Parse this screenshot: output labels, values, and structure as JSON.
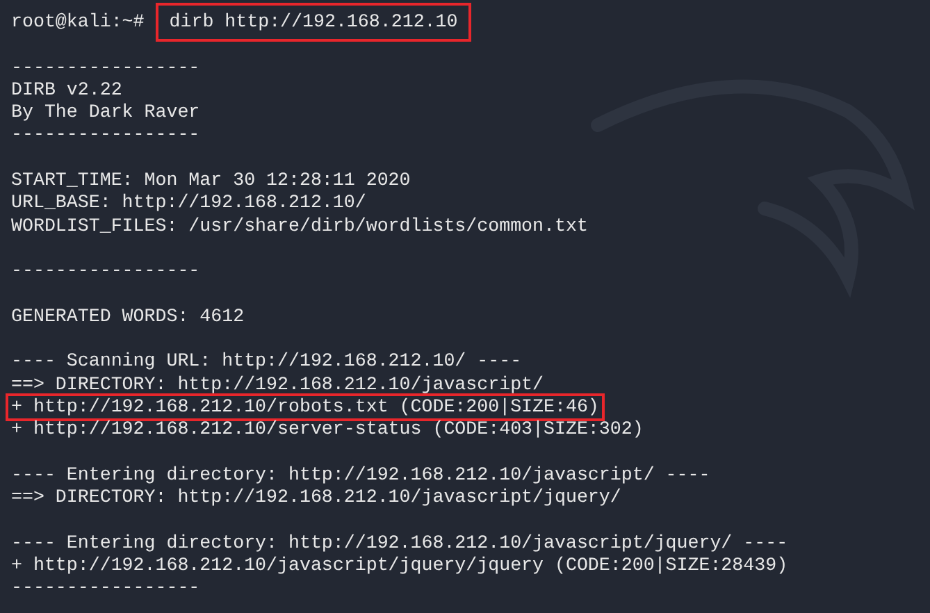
{
  "terminal": {
    "prompt": "root@kali:~#",
    "command": "dirb http://192.168.212.10",
    "command_highlighted": true,
    "lines": [
      {
        "kind": "blank"
      },
      {
        "kind": "text",
        "text": "-----------------",
        "highlighted": false
      },
      {
        "kind": "text",
        "text": "DIRB v2.22",
        "highlighted": false
      },
      {
        "kind": "text",
        "text": "By The Dark Raver",
        "highlighted": false
      },
      {
        "kind": "text",
        "text": "-----------------",
        "highlighted": false
      },
      {
        "kind": "blank"
      },
      {
        "kind": "text",
        "text": "START_TIME: Mon Mar 30 12:28:11 2020",
        "highlighted": false
      },
      {
        "kind": "text",
        "text": "URL_BASE: http://192.168.212.10/",
        "highlighted": false
      },
      {
        "kind": "text",
        "text": "WORDLIST_FILES: /usr/share/dirb/wordlists/common.txt",
        "highlighted": false
      },
      {
        "kind": "blank"
      },
      {
        "kind": "text",
        "text": "-----------------",
        "highlighted": false
      },
      {
        "kind": "blank"
      },
      {
        "kind": "text",
        "text": "GENERATED WORDS: 4612",
        "highlighted": false
      },
      {
        "kind": "blank"
      },
      {
        "kind": "text",
        "text": "---- Scanning URL: http://192.168.212.10/ ----",
        "highlighted": false
      },
      {
        "kind": "text",
        "text": "==> DIRECTORY: http://192.168.212.10/javascript/",
        "highlighted": false
      },
      {
        "kind": "text",
        "text": "+ http://192.168.212.10/robots.txt (CODE:200|SIZE:46)",
        "highlighted": true
      },
      {
        "kind": "text",
        "text": "+ http://192.168.212.10/server-status (CODE:403|SIZE:302)",
        "highlighted": false
      },
      {
        "kind": "blank"
      },
      {
        "kind": "text",
        "text": "---- Entering directory: http://192.168.212.10/javascript/ ----",
        "highlighted": false
      },
      {
        "kind": "text",
        "text": "==> DIRECTORY: http://192.168.212.10/javascript/jquery/",
        "highlighted": false
      },
      {
        "kind": "blank"
      },
      {
        "kind": "text",
        "text": "---- Entering directory: http://192.168.212.10/javascript/jquery/ ----",
        "highlighted": false
      },
      {
        "kind": "text",
        "text": "+ http://192.168.212.10/javascript/jquery/jquery (CODE:200|SIZE:28439)",
        "highlighted": false
      },
      {
        "kind": "text",
        "text": "-----------------",
        "highlighted": false
      }
    ]
  }
}
